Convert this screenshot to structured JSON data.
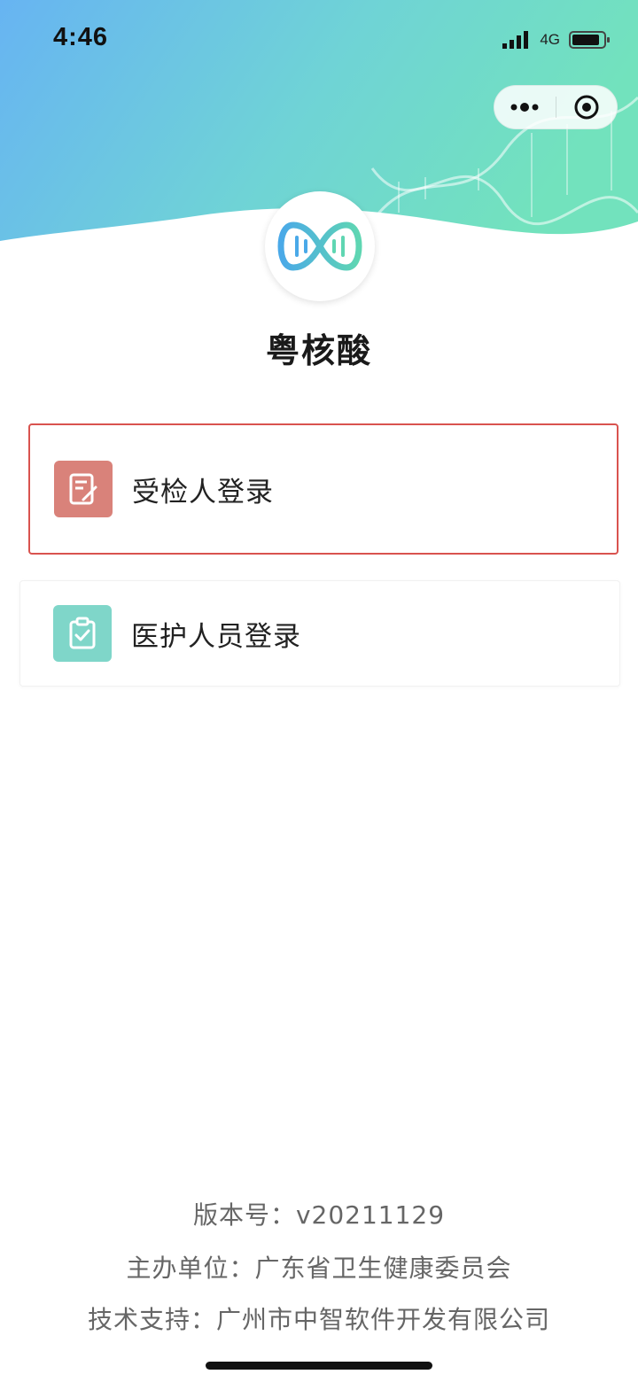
{
  "status_bar": {
    "time": "4:46",
    "network": "4G"
  },
  "app": {
    "title": "粤核酸"
  },
  "login_options": [
    {
      "label": "受检人登录",
      "icon": "edit-document-icon",
      "color": "#d9827a"
    },
    {
      "label": "医护人员登录",
      "icon": "clipboard-check-icon",
      "color": "#7fd6c9"
    }
  ],
  "footer": {
    "version": "版本号：v20211129",
    "organizer": "主办单位：广东省卫生健康委员会",
    "support": "技术支持：广州市中智软件开发有限公司"
  },
  "colors": {
    "header_left": "#67b4f2",
    "header_right": "#6ee0c0",
    "highlight_border": "#d9534f"
  }
}
